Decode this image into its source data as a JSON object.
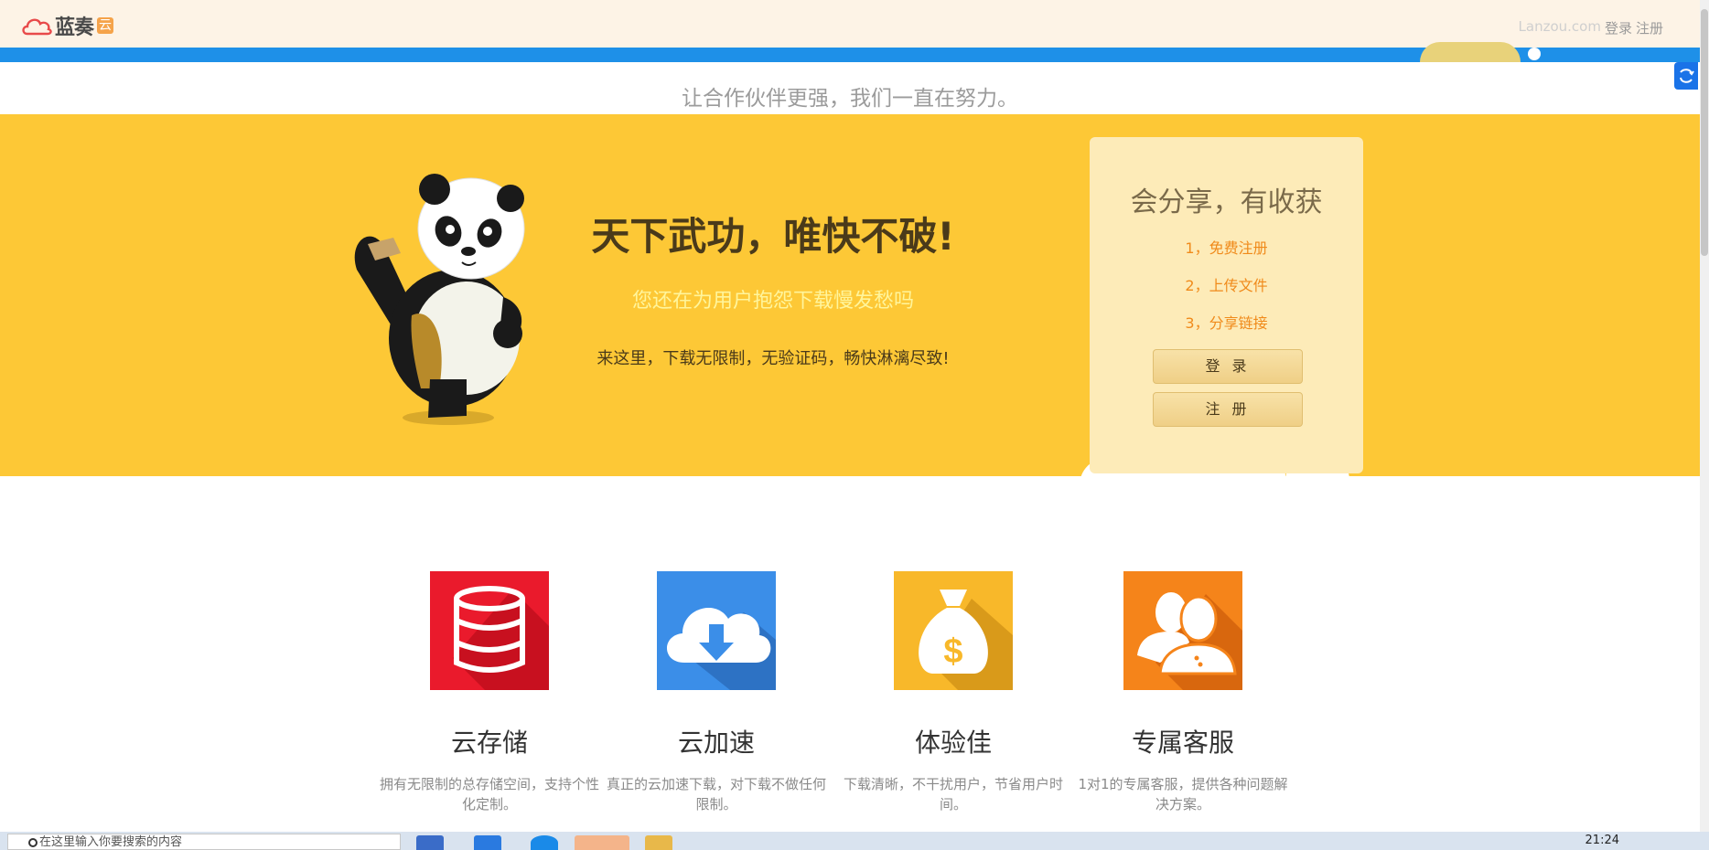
{
  "header": {
    "logo_text": "蓝奏",
    "logo_badge": "云",
    "site_name": "Lanzou.com",
    "login_link": "登录",
    "register_link": "注册"
  },
  "slogan": "让合作伙伴更强，我们一直在努力。",
  "hero": {
    "title": "天下武功，唯快不破!",
    "subtitle": "您还在为用户抱怨下载慢发愁吗",
    "description": "来这里，下载无限制，无验证码，畅快淋漓尽致!",
    "card": {
      "title": "会分享，有收获",
      "steps": [
        "1，免费注册",
        "2，上传文件",
        "3，分享链接"
      ],
      "login_button": "登 录",
      "register_button": "注 册"
    }
  },
  "features": [
    {
      "title": "云存储",
      "description": "拥有无限制的总存储空间，支持个性化定制。",
      "icon": "database-icon",
      "color": "#ea1a2c"
    },
    {
      "title": "云加速",
      "description": "真正的云加速下载，对下载不做任何限制。",
      "icon": "cloud-download-icon",
      "color": "#3b8ee8"
    },
    {
      "title": "体验佳",
      "description": "下载清晰，不干扰用户，节省用户时间。",
      "icon": "money-bag-icon",
      "color": "#f8b82a"
    },
    {
      "title": "专属客服",
      "description": "1对1的专属客服，提供各种问题解决方案。",
      "icon": "support-users-icon",
      "color": "#f5841a"
    }
  ],
  "taskbar": {
    "search_placeholder": "在这里输入你要搜索的内容",
    "clock": "21:24"
  },
  "colors": {
    "header_bg": "#fdf3e6",
    "accent_blue": "#1e90e8",
    "hero_bg": "#fdc836",
    "card_bg": "#fdebb8",
    "step_orange": "#f08a1a"
  }
}
